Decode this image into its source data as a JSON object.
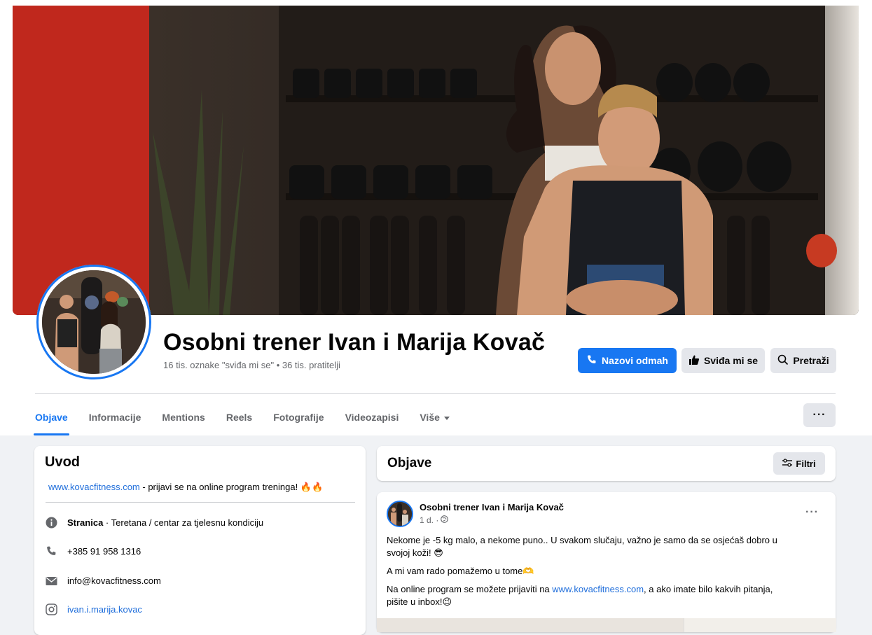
{
  "page": {
    "title": "Osobni trener Ivan i Marija Kovač",
    "stats": "16 tis. oznake \"sviđa mi se\" • 36 tis. pratitelji"
  },
  "actions": {
    "call_label": "Nazovi odmah",
    "like_label": "Sviđa mi se",
    "search_label": "Pretraži",
    "more_label": "···"
  },
  "tabs": [
    {
      "label": "Objave",
      "active": true
    },
    {
      "label": "Informacije"
    },
    {
      "label": "Mentions"
    },
    {
      "label": "Reels"
    },
    {
      "label": "Fotografije"
    },
    {
      "label": "Videozapisi"
    },
    {
      "label": "Više"
    }
  ],
  "intro": {
    "heading": "Uvod",
    "bio_link": "www.kovacfitness.com",
    "bio_text": " - prijavi se na online program treninga! 🔥🔥",
    "category_bold": "Stranica",
    "category_rest": " · Teretana / centar za tjelesnu kondiciju",
    "phone": "+385 91 958 1316",
    "email": "info@kovacfitness.com",
    "instagram": "ivan.i.marija.kovac"
  },
  "posts_section": {
    "heading": "Objave",
    "filter_label": "Filtri"
  },
  "post": {
    "author": "Osobni trener Ivan i Marija Kovač",
    "time": "1 d. ·",
    "more": "···",
    "line1": "Nekome je -5 kg malo, a nekome puno.. U svakom slučaju, važno je samo da se osjećaš dobro u",
    "line2": "svojoj koži! 😎",
    "line3": "A mi vam rado pomažemo u tome🫶",
    "line4_pre": "Na online program se možete prijaviti na ",
    "line4_link": "www.kovacfitness.com",
    "line4_post": ", a ako imate bilo kakvih pitanja,",
    "line5": "pišite u inbox!😉"
  },
  "colors": {
    "accent": "#1877f2",
    "link": "#216fdb",
    "secondary_text": "#65676b",
    "button_gray": "#e4e6eb"
  }
}
